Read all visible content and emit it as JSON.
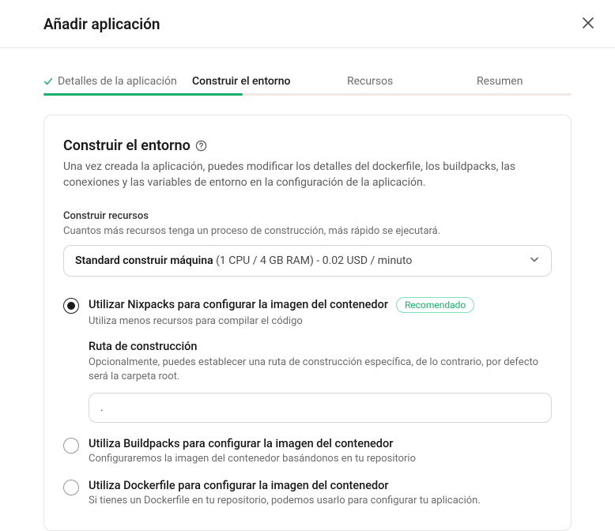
{
  "header": {
    "title": "Añadir aplicación"
  },
  "tabs": [
    {
      "label": "Detalles de la aplicación",
      "state": "completed"
    },
    {
      "label": "Construir el entorno",
      "state": "active"
    },
    {
      "label": "Recursos",
      "state": "pending"
    },
    {
      "label": "Resumen",
      "state": "pending"
    }
  ],
  "card": {
    "title": "Construir el entorno",
    "description": "Una vez creada la aplicación, puedes modificar los detalles del dockerfile, los buildpacks, las conexiones y las variables de entorno en la configuración de la aplicación."
  },
  "build_resources": {
    "label": "Construir recursos",
    "sub": "Cuantos más recursos tenga un proceso de construcción, más rápido se ejecutará.",
    "selected_name": "Standard construir máquina",
    "selected_spec": "(1 CPU / 4 GB RAM) - 0.02 USD / minuto"
  },
  "build_methods": {
    "badge_recommended": "Recomendado",
    "options": [
      {
        "id": "nixpacks",
        "title": "Utilizar Nixpacks para configurar la imagen del contenedor",
        "desc": "Utiliza menos recursos para compilar el código",
        "selected": true
      },
      {
        "id": "buildpacks",
        "title": "Utiliza Buildpacks para configurar la imagen del contenedor",
        "desc": "Configuraremos la imagen del contenedor basándonos en tu repositorio",
        "selected": false
      },
      {
        "id": "dockerfile",
        "title": "Utiliza Dockerfile para configurar la imagen del contenedor",
        "desc": "Si tienes un Dockerfile en tu repositorio, podemos usarlo para configurar tu aplicación.",
        "selected": false
      }
    ],
    "build_path": {
      "label": "Ruta de construcción",
      "desc": "Opcionalmente, puedes establecer una ruta de construcción específica, de lo contrario, por defecto será la carpeta root.",
      "value": "."
    }
  }
}
